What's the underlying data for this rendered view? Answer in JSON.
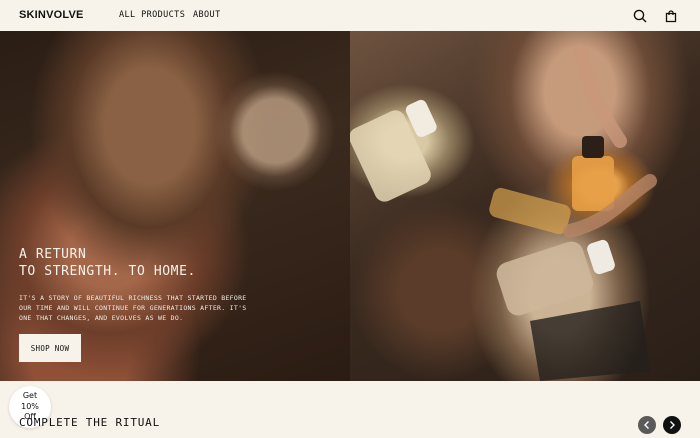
{
  "header": {
    "logo": "SKINVOLVE",
    "nav": [
      "ALL PRODUCTS",
      "ABOUT"
    ],
    "icons": [
      "search-icon",
      "cart-icon"
    ]
  },
  "hero": {
    "heading_lines": [
      "A RETURN",
      "TO STRENGTH. TO HOME."
    ],
    "body": "IT'S A STORY OF BEAUTIFUL RICHNESS THAT STARTED BEFORE OUR TIME AND WILL CONTINUE FOR GENERATIONS AFTER. IT'S ONE THAT CHANGES, AND EVOLVES AS WE DO.",
    "cta": "SHOP NOW"
  },
  "promo_badge": {
    "lines": [
      "Get",
      "10%",
      "Off"
    ]
  },
  "section": {
    "title": "COMPLETE THE RITUAL"
  },
  "colors": {
    "background": "#f7f3ea",
    "text": "#111111",
    "arrow_prev": "#5a5a5a",
    "arrow_next": "#111111"
  }
}
